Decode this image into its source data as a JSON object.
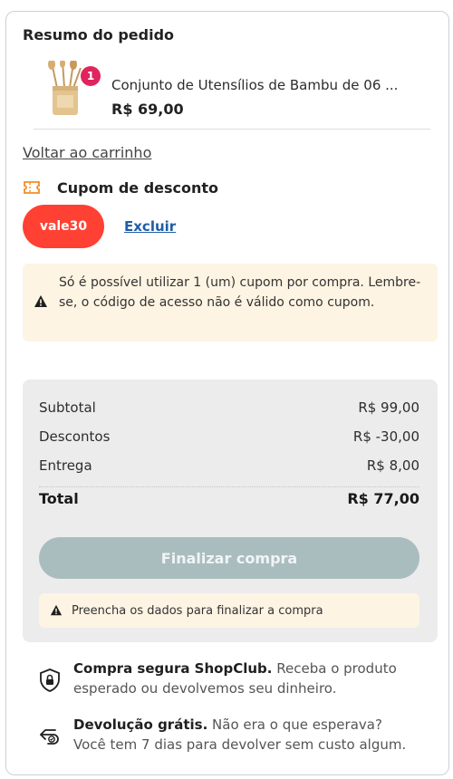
{
  "summary_title": "Resumo do pedido",
  "product": {
    "name": "Conjunto de Utensílios de Bambu de 06 ...",
    "price": "R$ 69,00",
    "quantity_badge": "1"
  },
  "back_link": "Voltar ao carrinho",
  "coupon": {
    "section_label": "Cupom de desconto",
    "code": "vale30",
    "remove_label": "Excluir",
    "notice": "Só é possível utilizar 1 (um) cupom por compra. Lembre-se, o código de acesso não é válido como cupom."
  },
  "totals": {
    "subtotal_label": "Subtotal",
    "subtotal_value": "R$ 99,00",
    "discount_label": "Descontos",
    "discount_value": "R$ -30,00",
    "shipping_label": "Entrega",
    "shipping_value": "R$ 8,00",
    "total_label": "Total",
    "total_value": "R$ 77,00"
  },
  "checkout": {
    "button_label": "Finalizar compra",
    "button_state": "disabled",
    "warning": "Preencha os dados para finalizar a compra"
  },
  "benefits": [
    {
      "title": "Compra segura ShopClub.",
      "text": "Receba o produto esperado ou devolvemos seu dinheiro.",
      "icon": "shield-lock-icon"
    },
    {
      "title": "Devolução grátis.",
      "text": "Não era o que esperava? Você tem 7 dias para devolver sem custo algum.",
      "icon": "return-arrow-icon"
    }
  ],
  "colors": {
    "coupon_chip": "#ff4133",
    "badge": "#e0245e",
    "link": "#1f5ea8",
    "coupon_icon": "#f28c28",
    "notice_bg": "#fdf4e3",
    "summary_bg": "#ececec",
    "finalize_disabled": "#a9bdbf"
  }
}
